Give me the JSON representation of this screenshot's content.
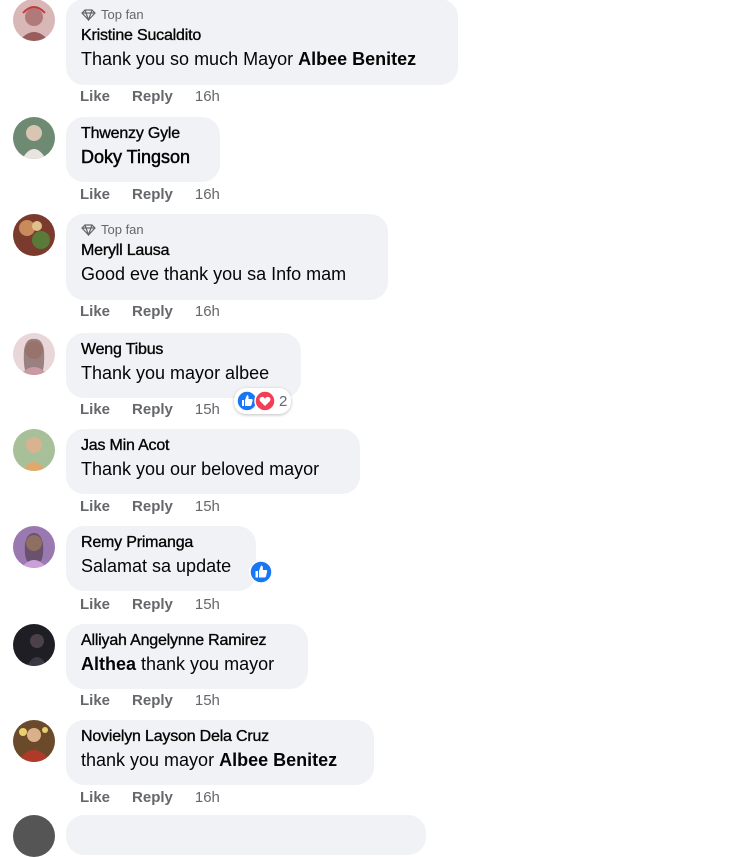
{
  "comments": [
    {
      "badge": "Top fan",
      "name": "Kristine Sucaldito",
      "text_plain": "Thank you so much Mayor ",
      "text_bold": "Albee Benitez",
      "like": "Like",
      "reply": "Reply",
      "time": "16h",
      "avatar_color": "#c9a3a3"
    },
    {
      "name": "Thwenzy Gyle",
      "text_bold": "Doky Tingson",
      "like": "Like",
      "reply": "Reply",
      "time": "16h",
      "avatar_color": "#8aa08c"
    },
    {
      "badge": "Top fan",
      "name": "Meryll Lausa",
      "text_plain": "Good eve thank you sa Info mam",
      "like": "Like",
      "reply": "Reply",
      "time": "16h",
      "avatar_color": "#a85a5a"
    },
    {
      "name": "Weng Tibus",
      "text_plain": "Thank you mayor albee",
      "like": "Like",
      "reply": "Reply",
      "time": "15h",
      "reaction_count": "2",
      "avatar_color": "#d6b2b8"
    },
    {
      "name": "Jas Min Acot",
      "text_plain": "Thank you our beloved mayor",
      "like": "Like",
      "reply": "Reply",
      "time": "15h",
      "avatar_color": "#9bb08a"
    },
    {
      "name": "Remy Primanga",
      "text_plain": "Salamat sa update",
      "like": "Like",
      "reply": "Reply",
      "time": "15h",
      "avatar_color": "#9b7fa8"
    },
    {
      "name": "Alliyah Angelynne Ramirez",
      "text_bold": "Althea",
      "text_plain": " thank you mayor",
      "like": "Like",
      "reply": "Reply",
      "time": "15h",
      "avatar_color": "#2b2b33"
    },
    {
      "name": "Novielyn Layson Dela Cruz",
      "text_plain": "thank you mayor ",
      "text_bold": "Albee Benitez",
      "like": "Like",
      "reply": "Reply",
      "time": "16h",
      "avatar_color": "#8a5a3a"
    }
  ],
  "colors": {
    "bubble": "#f0f2f5",
    "muted": "#65676b",
    "like_blue": "#1877f2",
    "love_red": "#f33e58"
  },
  "icons": [
    "top-fan-diamond-icon",
    "like-reaction-icon",
    "love-reaction-icon"
  ]
}
